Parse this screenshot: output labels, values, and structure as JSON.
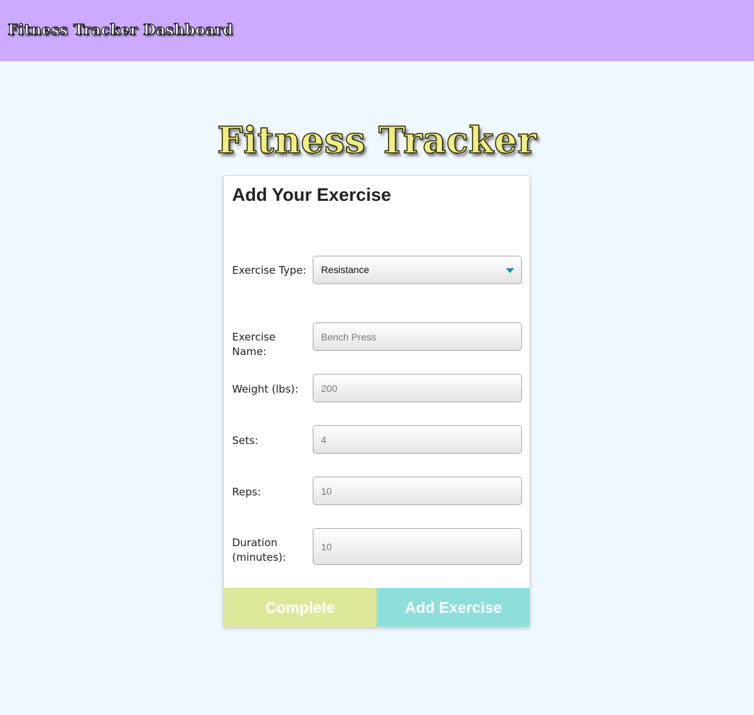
{
  "header": {
    "title": "Fitness Tracker Dashboard"
  },
  "hero": {
    "title": "Fitness Tracker"
  },
  "form": {
    "heading": "Add Your Exercise",
    "exercise_type": {
      "label": "Exercise Type:",
      "value": "Resistance"
    },
    "exercise_name": {
      "label": "Exercise Name:",
      "placeholder": "Bench Press"
    },
    "weight": {
      "label": "Weight (lbs):",
      "placeholder": "200"
    },
    "sets": {
      "label": "Sets:",
      "placeholder": "4"
    },
    "reps": {
      "label": "Reps:",
      "placeholder": "10"
    },
    "duration": {
      "label": "Duration (minutes):",
      "placeholder": "10"
    },
    "complete_label": "Complete",
    "add_label": "Add Exercise"
  },
  "colors": {
    "header_bg": "#cbaaff",
    "page_bg": "#f0f8ff",
    "complete_button": "#dfe89a",
    "add_button": "#8edfdb",
    "hero_text": "#f1ee84"
  }
}
